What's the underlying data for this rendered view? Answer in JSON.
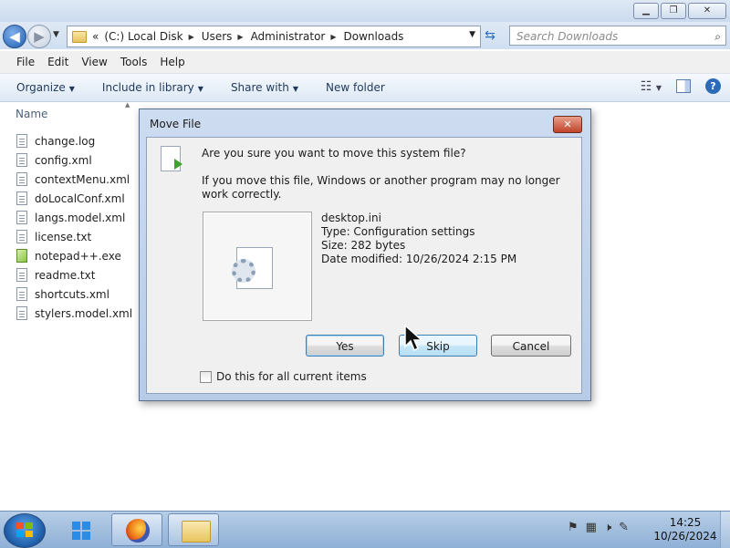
{
  "window": {
    "minimize_glyph": "▁",
    "maximize_glyph": "❐",
    "close_glyph": "✕"
  },
  "navigation": {
    "back_glyph": "◀",
    "forward_glyph": "▶",
    "address_prefix": "«",
    "breadcrumbs": [
      "(C:) Local Disk",
      "Users",
      "Administrator",
      "Downloads"
    ],
    "breadcrumb_separator": "▶",
    "search_placeholder": "Search Downloads"
  },
  "menu": [
    "File",
    "Edit",
    "View",
    "Tools",
    "Help"
  ],
  "toolbar": {
    "organize": "Organize",
    "include_in_library": "Include in library",
    "share_with": "Share with",
    "new_folder": "New folder"
  },
  "file_list": {
    "column_name": "Name",
    "files": [
      {
        "name": "change.log",
        "icon": "text-file-icon"
      },
      {
        "name": "config.xml",
        "icon": "text-file-icon"
      },
      {
        "name": "contextMenu.xml",
        "icon": "text-file-icon"
      },
      {
        "name": "doLocalConf.xml",
        "icon": "text-file-icon"
      },
      {
        "name": "langs.model.xml",
        "icon": "text-file-icon"
      },
      {
        "name": "license.txt",
        "icon": "text-file-icon"
      },
      {
        "name": "notepad++.exe",
        "icon": "notepad-plus-plus-icon"
      },
      {
        "name": "readme.txt",
        "icon": "text-file-icon"
      },
      {
        "name": "shortcuts.xml",
        "icon": "text-file-icon"
      },
      {
        "name": "stylers.model.xml",
        "icon": "text-file-icon"
      }
    ]
  },
  "dialog": {
    "title": "Move File",
    "question": "Are you sure you want to move this system file?",
    "warning": "If you move this file, Windows or another program may no longer work correctly.",
    "file_name": "desktop.ini",
    "file_type": "Type: Configuration settings",
    "file_size": "Size: 282 bytes",
    "file_modified": "Date modified: 10/26/2024 2:15 PM",
    "yes_label": "Yes",
    "skip_label": "Skip",
    "cancel_label": "Cancel",
    "checkbox_label": "Do this for all current items",
    "checkbox_checked": false
  },
  "taskbar": {
    "apps": [
      "windows-tiles-icon",
      "firefox-icon",
      "file-explorer-icon"
    ],
    "time": "14:25",
    "date": "10/26/2024"
  },
  "colors": {
    "accent": "#2c6bb8",
    "dialog_frame": "#b7cbe7",
    "close_button": "#c0442a"
  }
}
